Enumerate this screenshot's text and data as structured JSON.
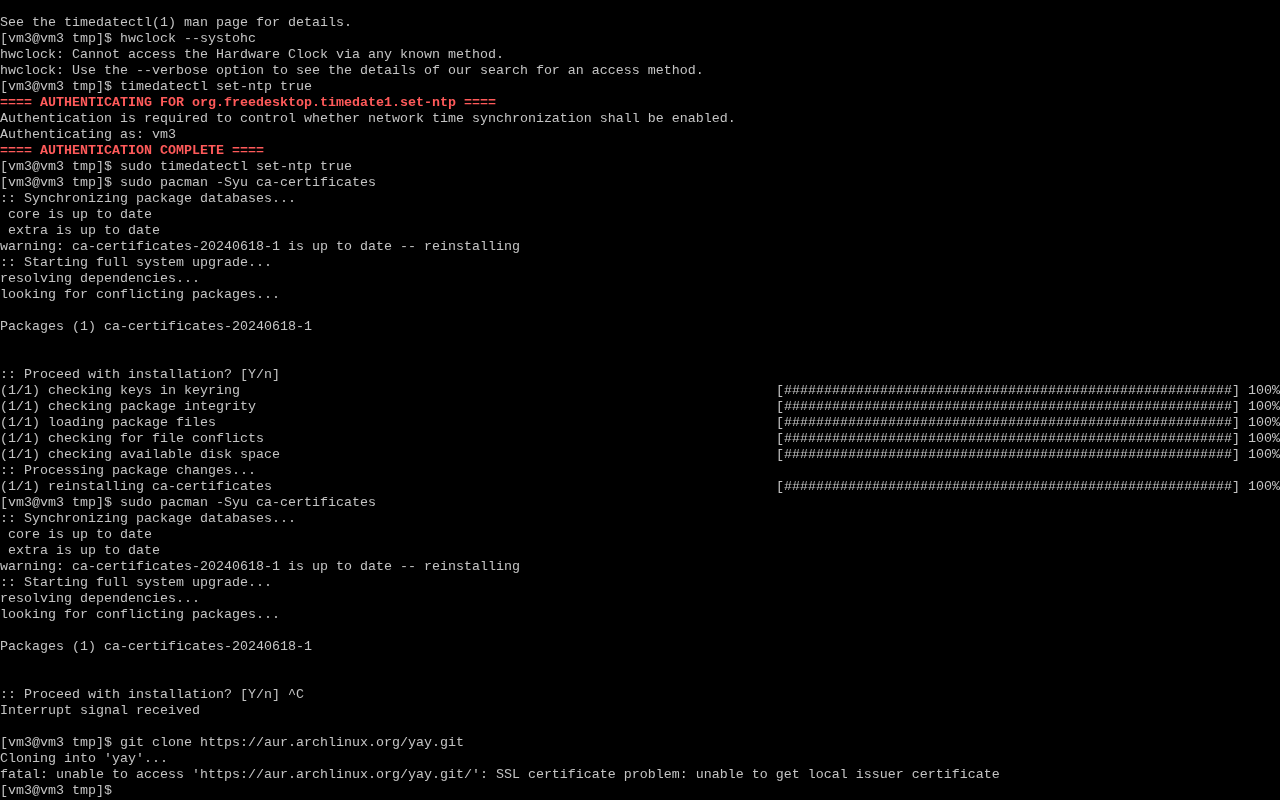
{
  "terminal": {
    "lines": [
      {
        "kind": "text",
        "text": "See the timedatectl(1) man page for details."
      },
      {
        "kind": "text",
        "text": "[vm3@vm3 tmp]$ hwclock --systohc"
      },
      {
        "kind": "text",
        "text": "hwclock: Cannot access the Hardware Clock via any known method."
      },
      {
        "kind": "text",
        "text": "hwclock: Use the --verbose option to see the details of our search for an access method."
      },
      {
        "kind": "text",
        "text": "[vm3@vm3 tmp]$ timedatectl set-ntp true"
      },
      {
        "kind": "alert",
        "text": "==== AUTHENTICATING FOR org.freedesktop.timedate1.set-ntp ===="
      },
      {
        "kind": "text",
        "text": "Authentication is required to control whether network time synchronization shall be enabled."
      },
      {
        "kind": "text",
        "text": "Authenticating as: vm3"
      },
      {
        "kind": "alert",
        "text": "==== AUTHENTICATION COMPLETE ===="
      },
      {
        "kind": "text",
        "text": "[vm3@vm3 tmp]$ sudo timedatectl set-ntp true"
      },
      {
        "kind": "text",
        "text": "[vm3@vm3 tmp]$ sudo pacman -Syu ca-certificates"
      },
      {
        "kind": "text",
        "text": ":: Synchronizing package databases..."
      },
      {
        "kind": "text",
        "text": " core is up to date"
      },
      {
        "kind": "text",
        "text": " extra is up to date"
      },
      {
        "kind": "text",
        "text": "warning: ca-certificates-20240618-1 is up to date -- reinstalling"
      },
      {
        "kind": "text",
        "text": ":: Starting full system upgrade..."
      },
      {
        "kind": "text",
        "text": "resolving dependencies..."
      },
      {
        "kind": "text",
        "text": "looking for conflicting packages..."
      },
      {
        "kind": "blank"
      },
      {
        "kind": "text",
        "text": "Packages (1) ca-certificates-20240618-1"
      },
      {
        "kind": "blank"
      },
      {
        "kind": "blank"
      },
      {
        "kind": "text",
        "text": ":: Proceed with installation? [Y/n]"
      },
      {
        "kind": "progress",
        "text": "(1/1) checking keys in keyring",
        "bar": "[########################################################]",
        "percent": "100%"
      },
      {
        "kind": "progress",
        "text": "(1/1) checking package integrity",
        "bar": "[########################################################]",
        "percent": "100%"
      },
      {
        "kind": "progress",
        "text": "(1/1) loading package files",
        "bar": "[########################################################]",
        "percent": "100%"
      },
      {
        "kind": "progress",
        "text": "(1/1) checking for file conflicts",
        "bar": "[########################################################]",
        "percent": "100%"
      },
      {
        "kind": "progress",
        "text": "(1/1) checking available disk space",
        "bar": "[########################################################]",
        "percent": "100%"
      },
      {
        "kind": "text",
        "text": ":: Processing package changes..."
      },
      {
        "kind": "progress",
        "text": "(1/1) reinstalling ca-certificates",
        "bar": "[########################################################]",
        "percent": "100%"
      },
      {
        "kind": "text",
        "text": "[vm3@vm3 tmp]$ sudo pacman -Syu ca-certificates"
      },
      {
        "kind": "text",
        "text": ":: Synchronizing package databases..."
      },
      {
        "kind": "text",
        "text": " core is up to date"
      },
      {
        "kind": "text",
        "text": " extra is up to date"
      },
      {
        "kind": "text",
        "text": "warning: ca-certificates-20240618-1 is up to date -- reinstalling"
      },
      {
        "kind": "text",
        "text": ":: Starting full system upgrade..."
      },
      {
        "kind": "text",
        "text": "resolving dependencies..."
      },
      {
        "kind": "text",
        "text": "looking for conflicting packages..."
      },
      {
        "kind": "blank"
      },
      {
        "kind": "text",
        "text": "Packages (1) ca-certificates-20240618-1"
      },
      {
        "kind": "blank"
      },
      {
        "kind": "blank"
      },
      {
        "kind": "text",
        "text": ":: Proceed with installation? [Y/n] ^C"
      },
      {
        "kind": "text",
        "text": "Interrupt signal received"
      },
      {
        "kind": "blank"
      },
      {
        "kind": "text",
        "text": "[vm3@vm3 tmp]$ git clone https://aur.archlinux.org/yay.git"
      },
      {
        "kind": "text",
        "text": "Cloning into 'yay'..."
      },
      {
        "kind": "text",
        "text": "fatal: unable to access 'https://aur.archlinux.org/yay.git/': SSL certificate problem: unable to get local issuer certificate"
      },
      {
        "kind": "text",
        "text": "[vm3@vm3 tmp]$"
      }
    ]
  }
}
